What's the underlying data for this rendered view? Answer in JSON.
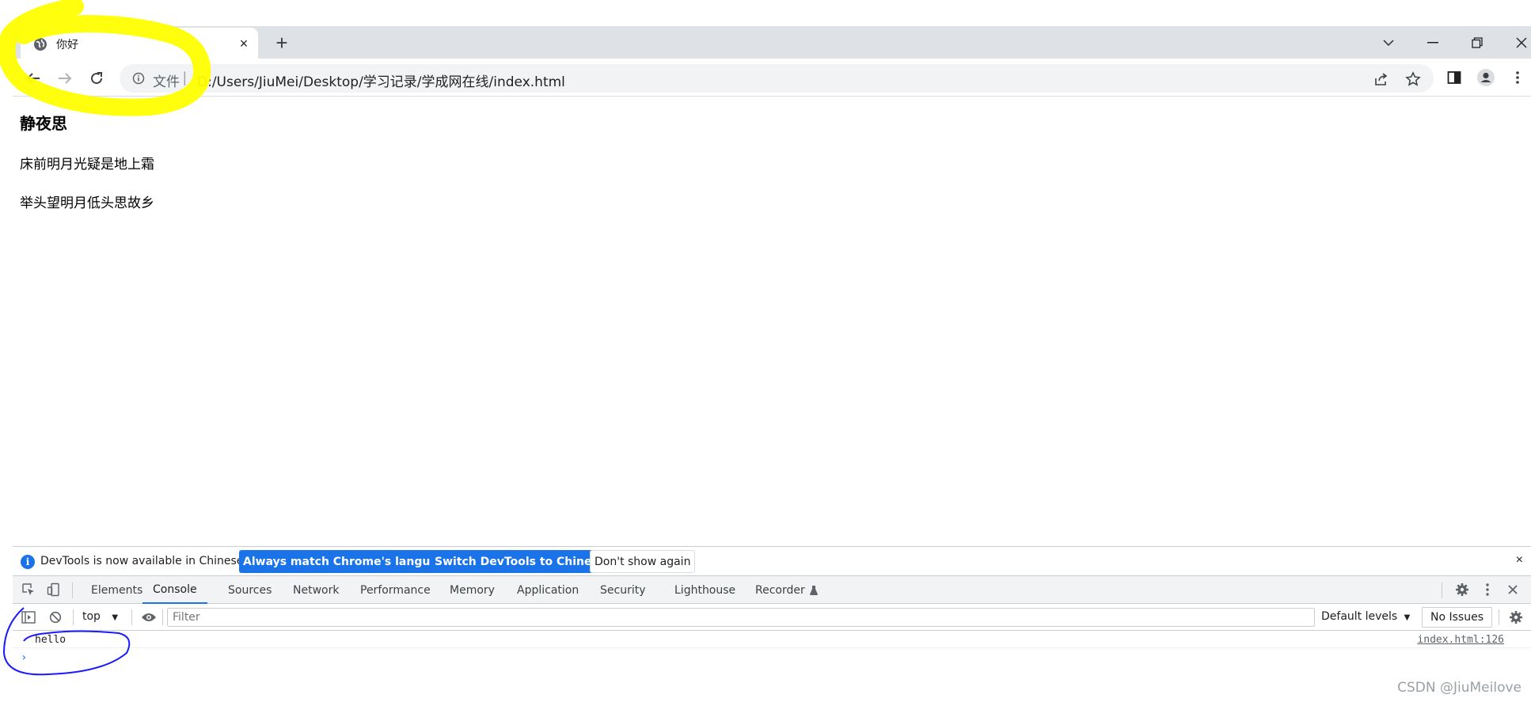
{
  "browser": {
    "tab": {
      "title": "你好",
      "close_label": "×"
    },
    "new_tab_label": "+",
    "address": {
      "scheme_label": "文件",
      "separator": "|",
      "url": "D:/Users/JiuMei/Desktop/学习记录/学成网在线/index.html"
    }
  },
  "page": {
    "heading": "静夜思",
    "lines": [
      "床前明月光疑是地上霜",
      "举头望明月低头思故乡"
    ]
  },
  "devtools": {
    "infobar": {
      "message": "DevTools is now available in Chinese!",
      "buttons": [
        "Always match Chrome's language",
        "Switch DevTools to Chinese",
        "Don't show again"
      ],
      "close_label": "×"
    },
    "tabs": [
      "Elements",
      "Console",
      "Sources",
      "Network",
      "Performance",
      "Memory",
      "Application",
      "Security",
      "Lighthouse",
      "Recorder"
    ],
    "active_tab": "Console",
    "console_toolbar": {
      "context": "top",
      "filter_placeholder": "Filter",
      "levels": "Default levels",
      "issues": "No Issues"
    },
    "messages": [
      {
        "text": "hello",
        "source": "index.html:126"
      }
    ],
    "prompt": "›"
  },
  "watermark": "CSDN @JiuMeilove",
  "colors": {
    "accent": "#1a73e8",
    "annotation_yellow": "#ffff00",
    "annotation_blue": "#1a1aff"
  }
}
